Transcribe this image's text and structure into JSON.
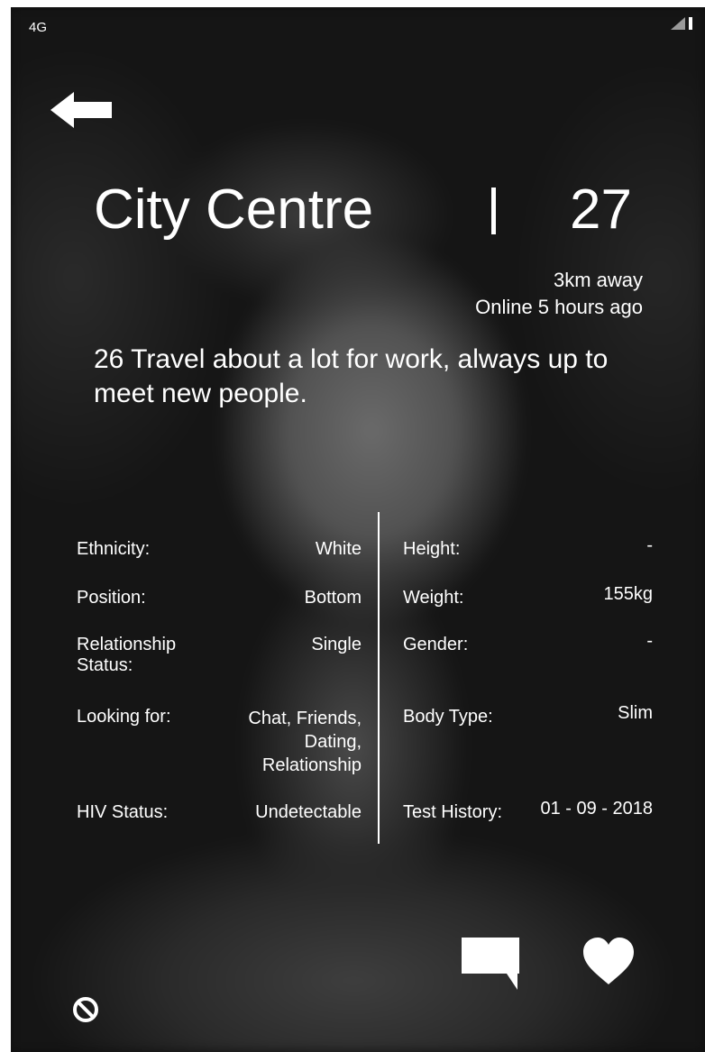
{
  "status_bar": {
    "network": "4G"
  },
  "header": {
    "location": "City Centre",
    "separator": "|",
    "age": "27",
    "distance": "3km away",
    "online_status": "Online 5 hours ago"
  },
  "bio": "26 Travel about a lot for work, always up to meet new people.",
  "details": {
    "left": [
      {
        "label": "Ethnicity:",
        "value": "White"
      },
      {
        "label": "Position:",
        "value": "Bottom"
      },
      {
        "label": "Relationship Status:",
        "value": "Single"
      },
      {
        "label": "Looking for:",
        "value": "Chat, Friends, Dating, Relationship"
      },
      {
        "label": "HIV Status:",
        "value": "Undetectable"
      }
    ],
    "right": [
      {
        "label": "Height:",
        "value": "-"
      },
      {
        "label": "Weight:",
        "value": "155kg"
      },
      {
        "label": "Gender:",
        "value": "-"
      },
      {
        "label": "Body Type:",
        "value": "Slim"
      },
      {
        "label": "Test History:",
        "value": "01 - 09 - 2018"
      }
    ]
  },
  "icons": {
    "back": "back-arrow-icon",
    "block": "block-icon",
    "chat": "chat-bubble-icon",
    "heart": "heart-icon",
    "signal": "signal-icon"
  },
  "colors": {
    "text": "#ffffff",
    "background": "#151515"
  }
}
